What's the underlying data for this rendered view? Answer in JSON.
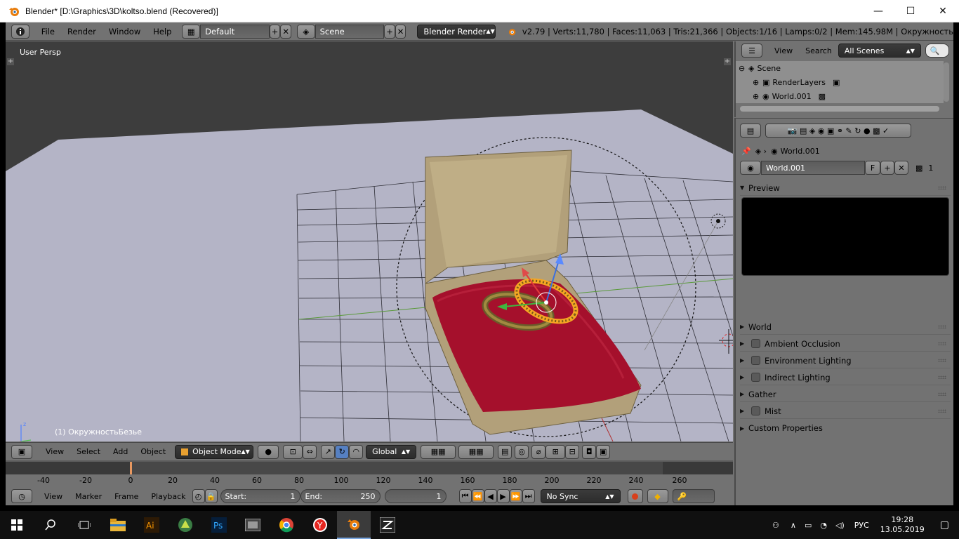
{
  "window": {
    "title": "Blender* [D:\\Graphics\\3D\\koltso.blend (Recovered)]",
    "minimize": "—",
    "maximize": "☐",
    "close": "✕"
  },
  "topbar": {
    "menus": [
      "File",
      "Render",
      "Window",
      "Help"
    ],
    "screen_layout": "Default",
    "scene": "Scene",
    "render_engine": "Blender Render",
    "stats": "v2.79 | Verts:11,780 | Faces:11,063 | Tris:21,366 | Objects:1/16 | Lamps:0/2 | Mem:145.98M | Окружность"
  },
  "viewport": {
    "view_label": "User Persp",
    "object_label": "(1) ОкружностьБезье",
    "header_menus": [
      "View",
      "Select",
      "Add",
      "Object"
    ],
    "mode": "Object Mode",
    "orientation": "Global"
  },
  "timeline": {
    "scale": [
      "-40",
      "-20",
      "0",
      "20",
      "40",
      "60",
      "80",
      "100",
      "120",
      "140",
      "160",
      "180",
      "200",
      "220",
      "240",
      "260"
    ],
    "menus": [
      "View",
      "Marker",
      "Frame",
      "Playback"
    ],
    "start_label": "Start:",
    "start_value": "1",
    "end_label": "End:",
    "end_value": "250",
    "current_frame": "1",
    "sync": "No Sync"
  },
  "outliner": {
    "view": "View",
    "search": "Search",
    "filter": "All Scenes",
    "items": [
      "Scene",
      "RenderLayers",
      "World.001"
    ]
  },
  "properties": {
    "breadcrumb": "World.001",
    "world_name": "World.001",
    "fake_user": "F",
    "users": "1",
    "panels": [
      "Preview",
      "World",
      "Ambient Occlusion",
      "Environment Lighting",
      "Indirect Lighting",
      "Gather",
      "Mist",
      "Custom Properties"
    ]
  },
  "taskbar": {
    "lang": "РУС",
    "time": "19:28",
    "date": "13.05.2019"
  },
  "colors": {
    "blender_bg": "#727272",
    "viewport_bg": "#3d3d3d",
    "floor": "#b2b2c4",
    "velvet": "#a0102a",
    "box_gold": "#b5a27a",
    "selection": "#f5a623"
  }
}
